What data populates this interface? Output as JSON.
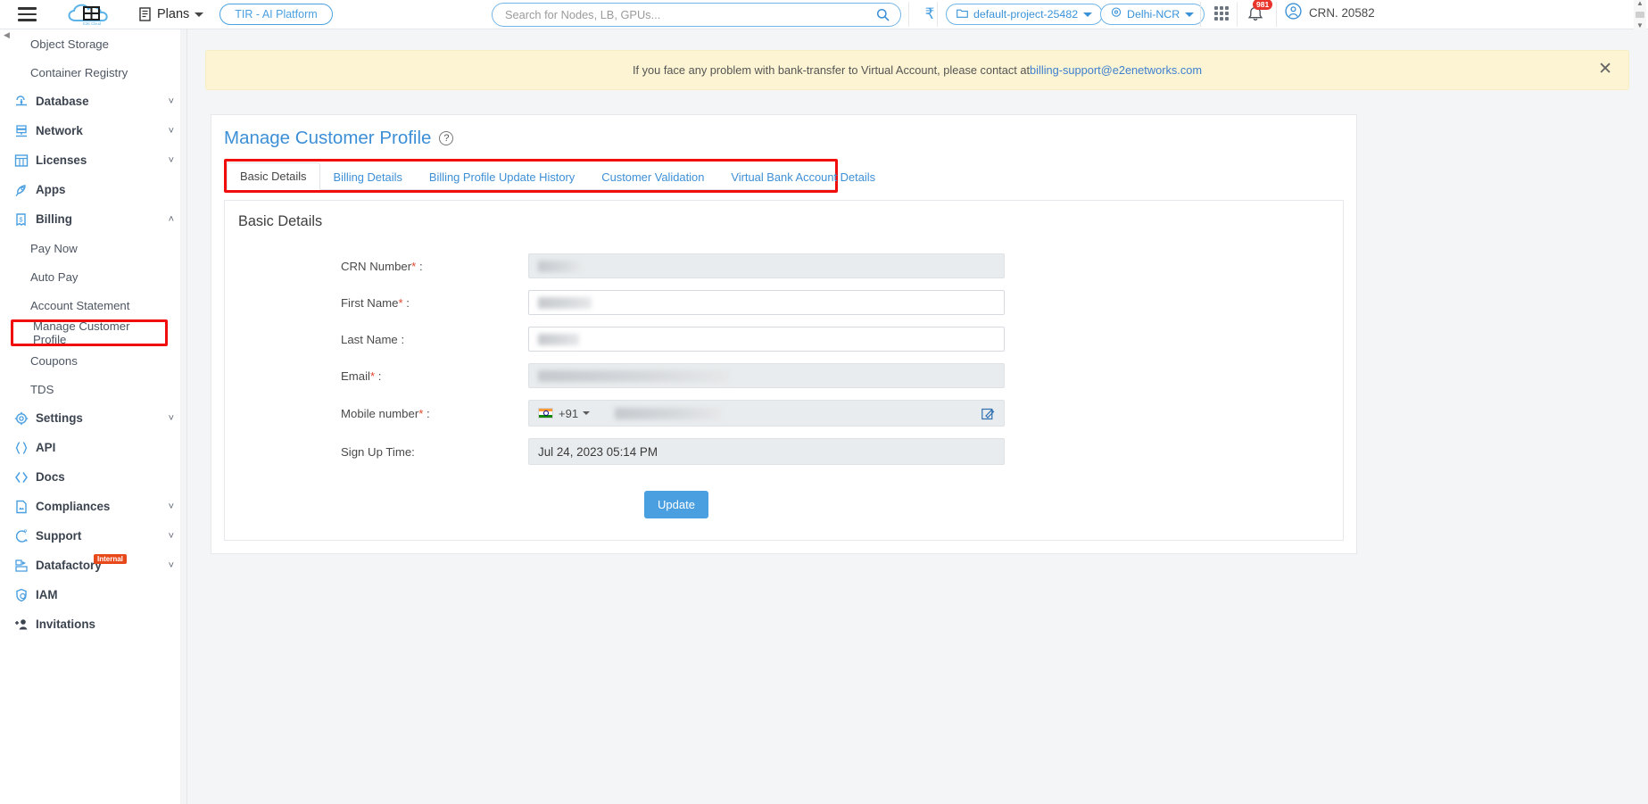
{
  "header": {
    "menu_icon": "hamburger-menu-icon",
    "logo_text": "E2E Cloud",
    "plans_label": "Plans",
    "tir_label": "TIR - AI Platform",
    "search": {
      "placeholder": "Search for Nodes, LB, GPUs...",
      "value": "",
      "icon": "search-icon"
    },
    "currency_icon": "rupee-icon",
    "project": "default-project-25482",
    "region": "Delhi-NCR",
    "apps_icon": "grid-apps-icon",
    "notifications": {
      "icon": "bell-icon",
      "count": "981"
    },
    "user": {
      "icon": "user-avatar-icon",
      "label": "CRN. 20582"
    }
  },
  "sidebar": {
    "items": [
      {
        "label": "Object Storage",
        "type": "sub"
      },
      {
        "label": "Container Registry",
        "type": "sub"
      },
      {
        "label": "Database",
        "type": "group",
        "icon": "database-icon",
        "chevron": "down"
      },
      {
        "label": "Network",
        "type": "group",
        "icon": "network-icon",
        "chevron": "down"
      },
      {
        "label": "Licenses",
        "type": "group",
        "icon": "licenses-icon",
        "chevron": "down"
      },
      {
        "label": "Apps",
        "type": "group",
        "icon": "rocket-icon",
        "chevron": ""
      },
      {
        "label": "Billing",
        "type": "group",
        "icon": "billing-icon",
        "chevron": "up"
      },
      {
        "label": "Pay Now",
        "type": "sub"
      },
      {
        "label": "Auto Pay",
        "type": "sub"
      },
      {
        "label": "Account Statement",
        "type": "sub"
      },
      {
        "label": "Manage Customer Profile",
        "type": "sub",
        "highlighted": true
      },
      {
        "label": "Coupons",
        "type": "sub"
      },
      {
        "label": "TDS",
        "type": "sub"
      },
      {
        "label": "Settings",
        "type": "group",
        "icon": "gear-icon",
        "chevron": "down"
      },
      {
        "label": "API",
        "type": "group",
        "icon": "braces-icon",
        "chevron": ""
      },
      {
        "label": "Docs",
        "type": "group",
        "icon": "code-icon",
        "chevron": ""
      },
      {
        "label": "Compliances",
        "type": "group",
        "icon": "document-icon",
        "chevron": "down"
      },
      {
        "label": "Support",
        "type": "group",
        "icon": "support-icon",
        "chevron": "down"
      },
      {
        "label": "Datafactory",
        "type": "group",
        "icon": "datafactory-icon",
        "chevron": "down",
        "badge": "Internal"
      },
      {
        "label": "IAM",
        "type": "group",
        "icon": "shield-user-icon",
        "chevron": ""
      },
      {
        "label": "Invitations",
        "type": "group",
        "icon": "add-user-icon",
        "chevron": ""
      }
    ]
  },
  "banner": {
    "text_before": "If you face any problem with bank-transfer to Virtual Account, please contact at ",
    "link": "billing-support@e2enetworks.com",
    "close_icon": "close-icon"
  },
  "page": {
    "title": "Manage Customer Profile",
    "help_icon": "help-circle-icon",
    "tabs": [
      {
        "label": "Basic Details",
        "active": true
      },
      {
        "label": "Billing Details",
        "active": false
      },
      {
        "label": "Billing Profile Update History",
        "active": false
      },
      {
        "label": "Customer Validation",
        "active": false
      },
      {
        "label": "Virtual Bank Account Details",
        "active": false
      }
    ],
    "panel_title": "Basic Details",
    "fields": [
      {
        "label": "CRN Number",
        "required": true,
        "value": "",
        "readonly": true,
        "redacted": "w1"
      },
      {
        "label": "First Name",
        "required": true,
        "value": "",
        "readonly": false,
        "redacted": "w2"
      },
      {
        "label": "Last Name",
        "required": false,
        "value": "",
        "readonly": false,
        "redacted": "w3"
      },
      {
        "label": "Email",
        "required": true,
        "value": "",
        "readonly": true,
        "redacted": "w4"
      },
      {
        "label": "Mobile number",
        "required": true,
        "value": "",
        "readonly": true,
        "redacted": "w5",
        "country_code": "+91",
        "flag": "india-flag-icon",
        "edit_icon": "edit-pencil-icon"
      },
      {
        "label": "Sign Up Time",
        "required": false,
        "value": "Jul 24, 2023 05:14 PM",
        "readonly": true
      }
    ],
    "update_button": "Update"
  },
  "colors": {
    "accent": "#4a9fe0",
    "highlight": "#f20d0d",
    "banner_bg": "#fcf4d2",
    "badge_red": "#e8342a",
    "internal_badge": "#e8491b"
  }
}
